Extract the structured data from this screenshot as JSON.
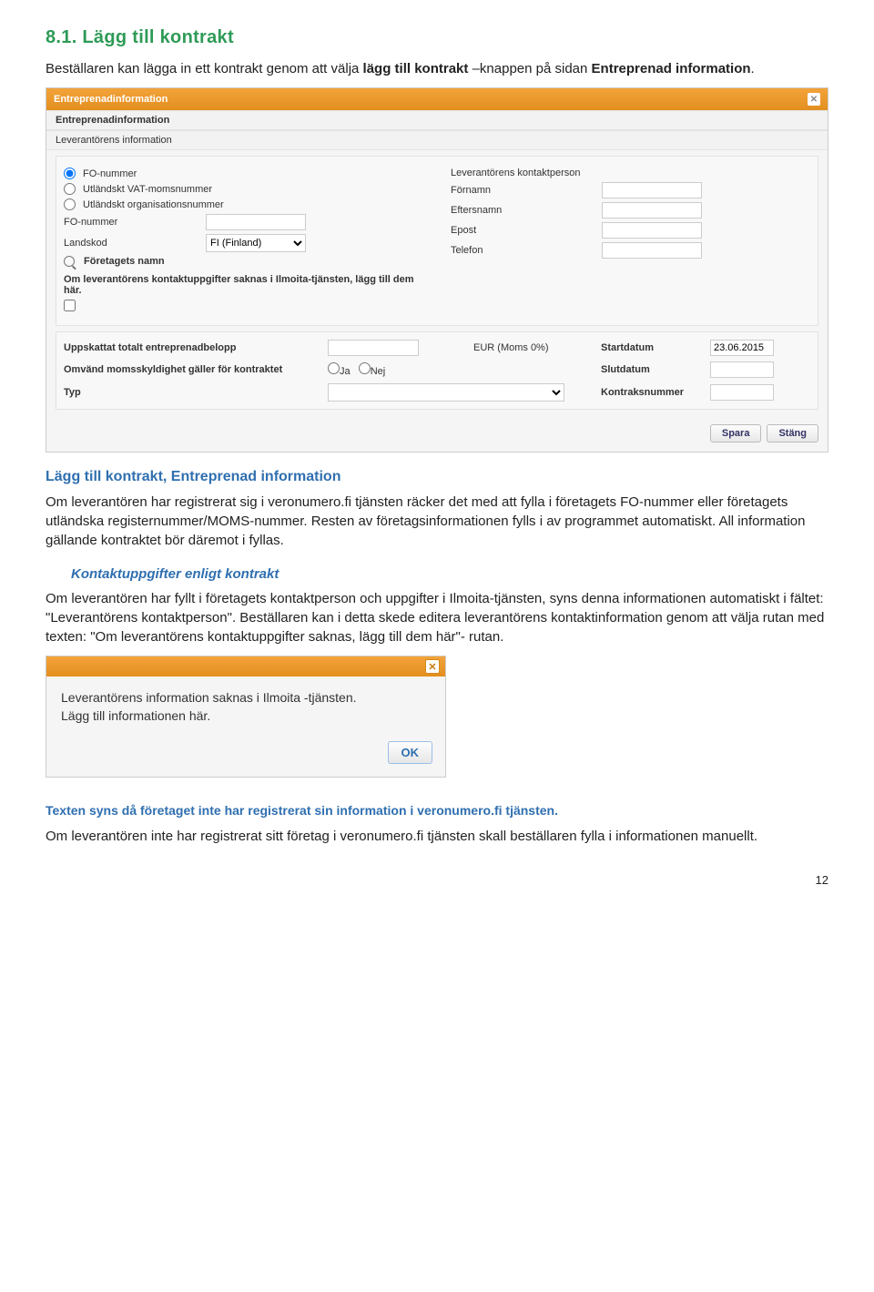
{
  "h1": "8.1.  Lägg till kontrakt",
  "p1_a": "Beställaren kan lägga in ett kontrakt genom att välja ",
  "p1_b": "lägg till kontrakt",
  "p1_c": " –knappen på sidan ",
  "p1_d": "Entreprenad information",
  "p1_e": ".",
  "shot1": {
    "title": "Entreprenadinformation",
    "section1": "Entreprenadinformation",
    "section2": "Leverantörens information",
    "radios": {
      "fo": "FO-nummer",
      "vat": "Utländskt VAT-momsnummer",
      "org": "Utländskt organisationsnummer"
    },
    "left_fields": {
      "fo_label": "FO-nummer",
      "landskod_label": "Landskod",
      "landskod_value": "FI (Finland)",
      "foretag_label": "Företagets namn"
    },
    "right_fields": {
      "kontakt": "Leverantörens kontaktperson",
      "fornamn": "Förnamn",
      "efternamn": "Eftersnamn",
      "epost": "Epost",
      "telefon": "Telefon"
    },
    "note": "Om leverantörens kontaktuppgifter saknas i Ilmoita-tjänsten, lägg till dem här.",
    "panel2": {
      "belopp": "Uppskattat totalt entreprenadbelopp",
      "eur": "EUR (Moms 0%)",
      "startdatum": "Startdatum",
      "startdatum_val": "23.06.2015",
      "omvand": "Omvänd momsskyldighet gäller för kontraktet",
      "ja": "Ja",
      "nej": "Nej",
      "slutdatum": "Slutdatum",
      "typ": "Typ",
      "kontraknr": "Kontraksnummer"
    },
    "buttons": {
      "spara": "Spara",
      "stang": "Stäng"
    }
  },
  "h2": "Lägg till kontrakt, Entreprenad information",
  "p2": "Om leverantören har registrerat sig i veronumero.fi tjänsten räcker det med att fylla i företagets FO-nummer eller företagets utländska registernummer/MOMS-nummer. Resten av företagsinformationen fylls i av programmet automatiskt. All information gällande kontraktet bör däremot i fyllas.",
  "h3": "Kontaktuppgifter enligt kontrakt",
  "p3": "Om leverantören har fyllt i företagets kontaktperson och uppgifter i Ilmoita-tjänsten, syns denna informationen automatiskt i fältet: \"Leverantörens kontaktperson\". Beställaren kan i detta skede editera leverantörens kontaktinformation genom att välja rutan med texten: \"Om leverantörens kontaktuppgifter saknas, lägg till dem här\"- rutan.",
  "shot2": {
    "line1": "Leverantörens information saknas i Ilmoita -tjänsten.",
    "line2": "Lägg till informationen här.",
    "ok": "OK"
  },
  "caption2": "Texten syns då företaget inte har registrerat sin information i veronumero.fi tjänsten.",
  "p4": "Om leverantören inte har registrerat sitt företag i veronumero.fi tjänsten skall beställaren fylla i informationen manuellt.",
  "pagenum": "12"
}
